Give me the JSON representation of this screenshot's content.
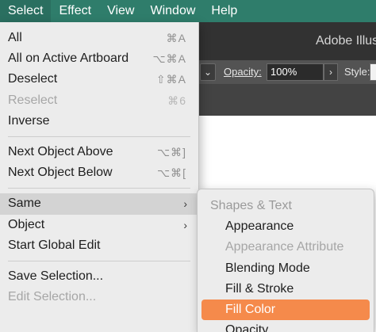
{
  "menubar": {
    "items": [
      "Select",
      "Effect",
      "View",
      "Window",
      "Help"
    ]
  },
  "app": {
    "title": "Adobe Illus",
    "opacity_label": "Opacity:",
    "opacity_value": "100%",
    "style_label": "Style:",
    "dropdown_glyph": "⌄",
    "arrow_glyph": "›"
  },
  "select_menu": {
    "items": [
      {
        "label": "All",
        "shortcut": "⌘A"
      },
      {
        "label": "All on Active Artboard",
        "shortcut": "⌥⌘A"
      },
      {
        "label": "Deselect",
        "shortcut": "⇧⌘A"
      },
      {
        "label": "Reselect",
        "shortcut": "⌘6"
      },
      {
        "label": "Inverse"
      },
      {
        "label": "Next Object Above",
        "shortcut": "⌥⌘]"
      },
      {
        "label": "Next Object Below",
        "shortcut": "⌥⌘["
      },
      {
        "label": "Same",
        "arrow": "›"
      },
      {
        "label": "Object",
        "arrow": "›"
      },
      {
        "label": "Start Global Edit"
      },
      {
        "label": "Save Selection..."
      },
      {
        "label": "Edit Selection..."
      }
    ]
  },
  "same_submenu": {
    "items": [
      {
        "label": "Shapes & Text"
      },
      {
        "label": "Appearance"
      },
      {
        "label": "Appearance Attribute"
      },
      {
        "label": "Blending Mode"
      },
      {
        "label": "Fill & Stroke"
      },
      {
        "label": "Fill Color"
      },
      {
        "label": "Opacity"
      }
    ]
  },
  "colors": {
    "menubar": "#2f7d6b",
    "highlight": "#f58a4b",
    "disabled_text": "#a6a6a6"
  }
}
